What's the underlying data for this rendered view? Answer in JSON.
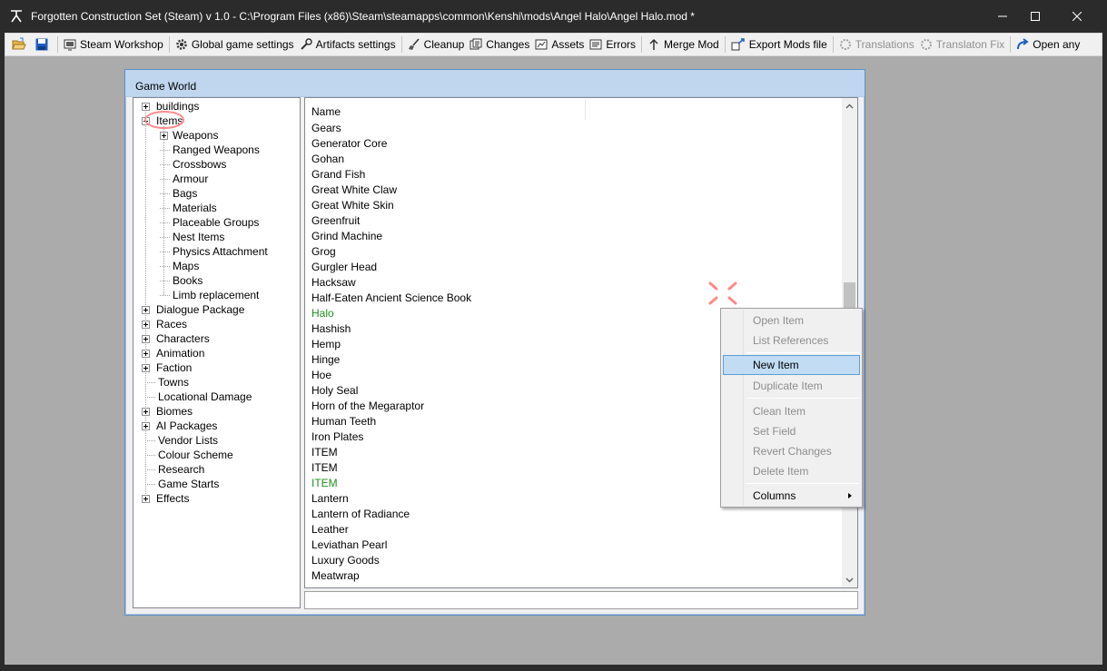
{
  "window": {
    "title": "Forgotten Construction Set (Steam) v 1.0 - C:\\Program Files (x86)\\Steam\\steamapps\\common\\Kenshi\\mods\\Angel Halo\\Angel Halo.mod *",
    "minimize_icon": "minimize-icon",
    "maximize_icon": "maximize-icon",
    "close_icon": "close-icon"
  },
  "toolbar": {
    "open_icon": "folder-open-icon",
    "save_icon": "save-disk-icon",
    "steam_workshop": "Steam Workshop",
    "global_settings": "Global game settings",
    "artifacts_settings": "Artifacts settings",
    "cleanup": "Cleanup",
    "changes": "Changes",
    "assets": "Assets",
    "errors": "Errors",
    "merge_mod": "Merge Mod",
    "export_mods": "Export Mods file",
    "translations": "Translations",
    "translation_fix": "Translaton Fix",
    "open_any": "Open any"
  },
  "child_window": {
    "title": "Game World"
  },
  "tree": {
    "buildings": "buildings",
    "items": "Items",
    "items_children": [
      "Weapons",
      "Ranged Weapons",
      "Crossbows",
      "Armour",
      "Bags",
      "Materials",
      "Placeable Groups",
      "Nest Items",
      "Physics Attachment",
      "Maps",
      "Books",
      "Limb replacement"
    ],
    "roots_after": [
      "Dialogue Package",
      "Races",
      "Characters",
      "Animation",
      "Faction",
      "Towns",
      "Locational Damage",
      "Biomes",
      "AI Packages",
      "Vendor Lists",
      "Colour Scheme",
      "Research",
      "Game Starts",
      "Effects"
    ]
  },
  "list": {
    "column_name": "Name",
    "items": [
      "Gears",
      "Generator Core",
      "Gohan",
      "Grand Fish",
      "Great White Claw",
      "Great White Skin",
      "Greenfruit",
      "Grind Machine",
      "Grog",
      "Gurgler Head",
      "Hacksaw",
      "Half-Eaten Ancient Science Book",
      "Halo",
      "Hashish",
      "Hemp",
      "Hinge",
      "Hoe",
      "Holy Seal",
      "Horn of the Megaraptor",
      "Human Teeth",
      "Iron Plates",
      "ITEM",
      "ITEM",
      "ITEM",
      "Lantern",
      "Lantern of Radiance",
      "Leather",
      "Leviathan Pearl",
      "Luxury Goods",
      "Meatwrap"
    ],
    "highlight_color": "#1f8f1f"
  },
  "context_menu": {
    "open_item": "Open Item",
    "list_references": "List References",
    "new_item": "New Item",
    "duplicate_item": "Duplicate Item",
    "clean_item": "Clean Item",
    "set_field": "Set Field",
    "revert_changes": "Revert Changes",
    "delete_item": "Delete Item",
    "columns": "Columns"
  }
}
